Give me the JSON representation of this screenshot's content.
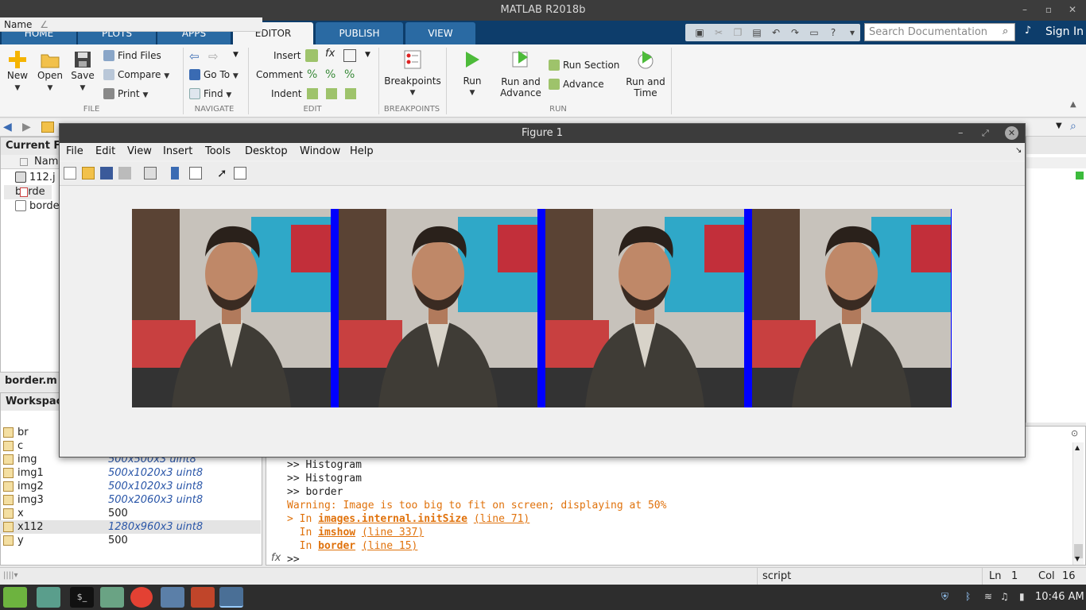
{
  "window": {
    "title": "MATLAB R2018b"
  },
  "tabs": [
    "HOME",
    "PLOTS",
    "APPS",
    "EDITOR",
    "PUBLISH",
    "VIEW"
  ],
  "search": {
    "placeholder": "Search Documentation"
  },
  "account": {
    "sign_in": "Sign In"
  },
  "toolstrip": {
    "file": {
      "label": "FILE",
      "new": "New",
      "open": "Open",
      "save": "Save",
      "find_files": "Find Files",
      "compare": "Compare",
      "print": "Print"
    },
    "navigate": {
      "label": "NAVIGATE",
      "go_to": "Go To",
      "find": "Find"
    },
    "edit": {
      "label": "EDIT",
      "insert": "Insert",
      "comment": "Comment",
      "indent": "Indent"
    },
    "breakpoints": {
      "label": "BREAKPOINTS",
      "breakpoints": "Breakpoints"
    },
    "run": {
      "label": "RUN",
      "run": "Run",
      "run_and_advance": "Run and Advance",
      "run_section": "Run Section",
      "advance": "Advance",
      "run_and_time": "Run and Time"
    }
  },
  "current_folder": {
    "title": "Current F",
    "col_name": "Nam",
    "files": [
      "112.j",
      "borde",
      "borde"
    ]
  },
  "details": {
    "title": "border.m"
  },
  "workspace": {
    "title": "Workspac",
    "col_name": "Name",
    "sort_arrow": "∠",
    "vars": [
      {
        "name": "br",
        "value": ""
      },
      {
        "name": "c",
        "value": ""
      },
      {
        "name": "img",
        "value": "500x500x3 uint8"
      },
      {
        "name": "img1",
        "value": "500x1020x3 uint8"
      },
      {
        "name": "img2",
        "value": "500x1020x3 uint8"
      },
      {
        "name": "img3",
        "value": "500x2060x3 uint8"
      },
      {
        "name": "x",
        "value": "500"
      },
      {
        "name": "x112",
        "value": "1280x960x3 uint8"
      },
      {
        "name": "y",
        "value": "500"
      }
    ]
  },
  "command_window": {
    "lines": [
      ">> Histogram",
      ">> Histogram",
      ">> border"
    ],
    "warning": "Warning: Image is too big to fit on screen; displaying at 50%",
    "trace1_pre": "> In ",
    "trace1_fn": "images.internal.initSize",
    "trace1_line": "(line 71)",
    "trace2_pre": "  In ",
    "trace2_fn": "imshow",
    "trace2_line": "(line 337)",
    "trace3_pre": "  In ",
    "trace3_fn": "border",
    "trace3_line": "(line 15)",
    "prompt": ">>",
    "fx": "fx"
  },
  "status": {
    "mode": "script",
    "ln_label": "Ln",
    "ln": "1",
    "col_label": "Col",
    "col": "16"
  },
  "clock": "10:46 AM",
  "figure": {
    "title": "Figure 1",
    "menu": [
      "File",
      "Edit",
      "View",
      "Insert",
      "Tools",
      "Desktop",
      "Window",
      "Help"
    ],
    "border_color": "#0000ff"
  }
}
